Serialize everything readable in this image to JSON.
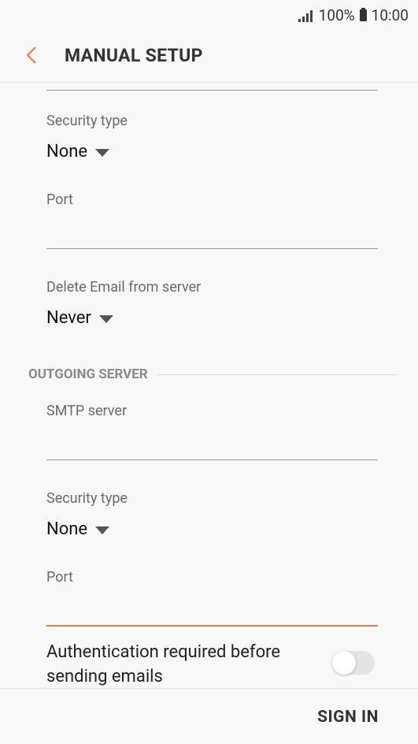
{
  "status_bar": {
    "battery": "100%",
    "time": "10:00"
  },
  "header": {
    "title": "MANUAL SETUP"
  },
  "incoming": {
    "security_type_label": "Security type",
    "security_type_value": "None",
    "port_label": "Port",
    "port_value": "",
    "delete_label": "Delete Email from server",
    "delete_value": "Never"
  },
  "outgoing": {
    "section_title": "OUTGOING SERVER",
    "smtp_label": "SMTP server",
    "smtp_value": "",
    "security_type_label": "Security type",
    "security_type_value": "None",
    "port_label": "Port",
    "port_value": "",
    "auth_label": "Authentication required before sending emails",
    "auth_enabled": false
  },
  "footer": {
    "sign_in_label": "SIGN IN"
  },
  "colors": {
    "accent": "#e57e4f",
    "background": "#f8f8f8"
  }
}
